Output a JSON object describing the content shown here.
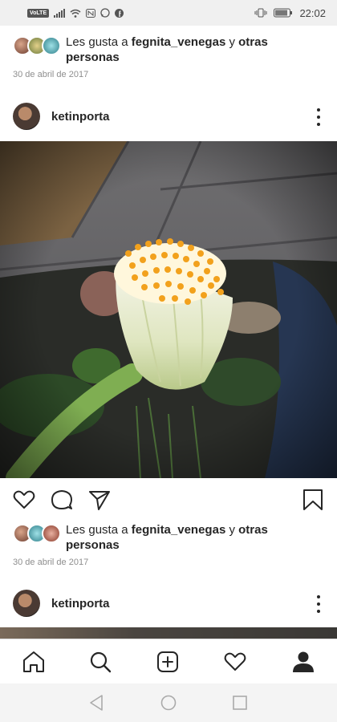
{
  "status_bar": {
    "network_badge": "VoLTE",
    "time": "22:02"
  },
  "post1": {
    "likes": {
      "prefix": "Les gusta a ",
      "user": "fegnita_venegas",
      "connector": " y ",
      "others": "otras personas"
    },
    "date": "30 de abril de 2017"
  },
  "post2": {
    "username": "ketinporta",
    "likes": {
      "prefix": "Les gusta a ",
      "user": "fegnita_venegas",
      "connector": " y ",
      "others": "otras personas"
    },
    "date": "30 de abril de 2017"
  },
  "post3": {
    "username": "ketinporta"
  },
  "bottom_nav": [
    "home-icon",
    "search-icon",
    "new-post-icon",
    "activity-icon",
    "profile-icon"
  ],
  "android_nav": [
    "back-icon",
    "home-circle-icon",
    "recents-icon"
  ]
}
